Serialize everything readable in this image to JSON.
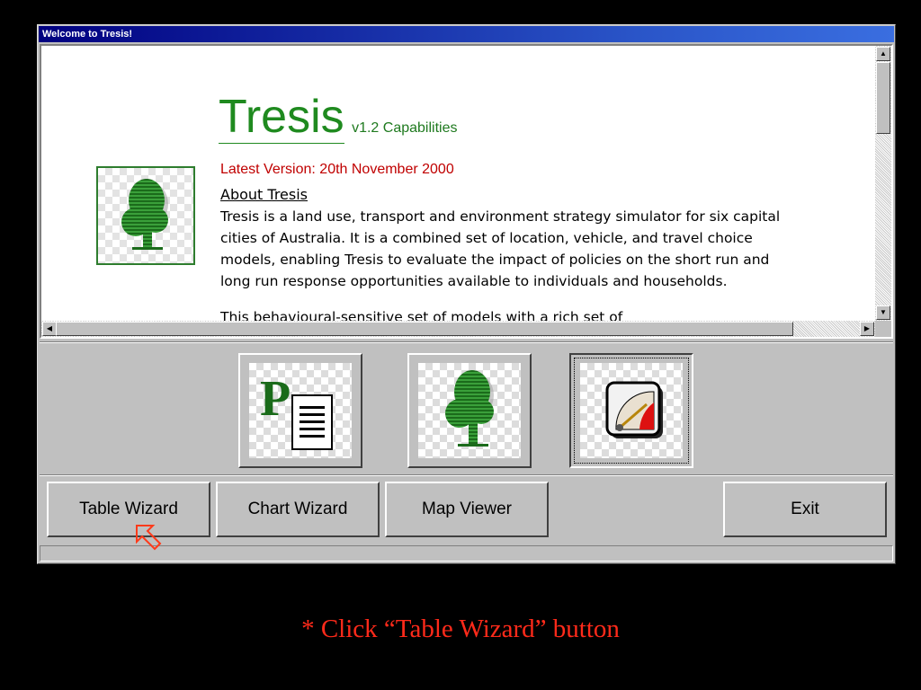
{
  "window": {
    "title": "Welcome to Tresis!"
  },
  "content": {
    "brand_name": "Tresis",
    "brand_version": "v1.2 Capabilities",
    "latest_version": "Latest Version: 20th November 2000",
    "about_heading": "About Tresis",
    "about_text": "Tresis is a land use, transport and environment strategy simulator for six capital cities of Australia. It is a combined set of location, vehicle, and travel choice models, enabling Tresis to evaluate the impact of policies on the short run and long run response opportunities available to individuals and households.",
    "partial_line": "This behavioural-sensitive set of models with a rich set of"
  },
  "icon_buttons": [
    {
      "icon": "report-document-icon",
      "letter": "P"
    },
    {
      "icon": "tree-icon"
    },
    {
      "icon": "gauge-icon"
    }
  ],
  "buttons": {
    "table_wizard": "Table Wizard",
    "chart_wizard": "Chart Wizard",
    "map_viewer": "Map Viewer",
    "exit": "Exit"
  },
  "instruction": "* Click “Table Wizard” button",
  "colors": {
    "brand_green": "#1f8a1f",
    "latest_red": "#c00000",
    "instruction_red": "#ff2a1a",
    "titlebar": "#000080"
  }
}
